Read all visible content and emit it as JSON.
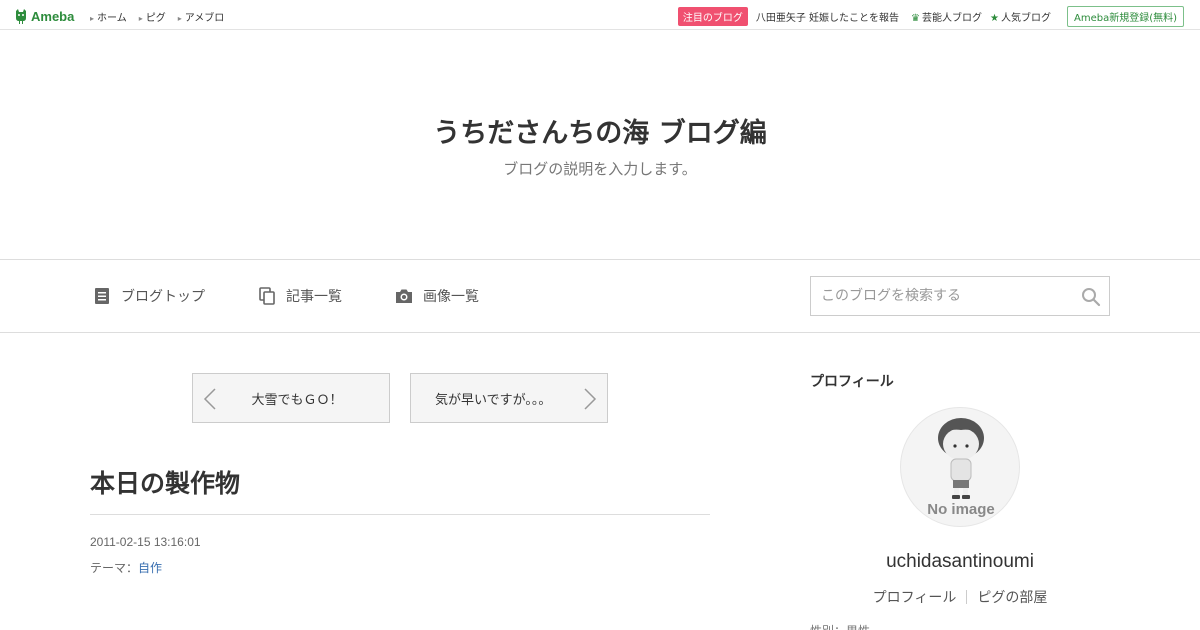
{
  "topbar": {
    "logo": "Ameba",
    "nav": [
      "ホーム",
      "ピグ",
      "アメブロ"
    ],
    "badge": "注目のブログ",
    "headline": "八田亜矢子 妊娠したことを報告",
    "celeb": "芸能人ブログ",
    "popular": "人気ブログ",
    "signup": "Ameba新規登録(無料)"
  },
  "header": {
    "title": "うちださんちの海 ブログ編",
    "description": "ブログの説明を入力します。"
  },
  "navbar": {
    "top": "ブログトップ",
    "articles": "記事一覧",
    "images": "画像一覧",
    "search_placeholder": "このブログを検索する"
  },
  "entry": {
    "prev": "大雪でもＧＯ！",
    "next": "気が早いですが。。。",
    "title": "本日の製作物",
    "date": "2011-02-15 13:16:01",
    "theme_label": "テーマ：",
    "theme": "自作"
  },
  "sidebar": {
    "heading": "プロフィール",
    "avatar_text": "No image",
    "username": "uchidasantinoumi",
    "profile_link": "プロフィール",
    "pig_link": "ピグの部屋",
    "cut_text": "性別：男性"
  },
  "colors": {
    "brand": "#2d8c3c",
    "badge": "#f05070",
    "link": "#3a6fb0"
  }
}
